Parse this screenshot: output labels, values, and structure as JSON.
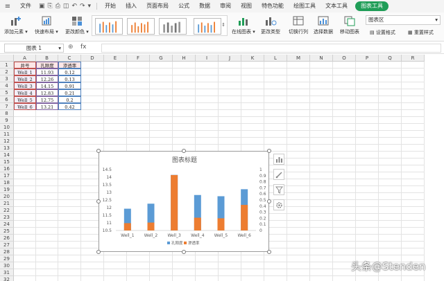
{
  "menu": {
    "items": [
      "文件",
      "开始",
      "插入",
      "页面布局",
      "公式",
      "数据",
      "审阅",
      "视图",
      "特色功能",
      "绘图工具",
      "文本工具"
    ],
    "active": "图表工具"
  },
  "ribbon": {
    "add_element": "添加元素",
    "quick_layout": "快速布局",
    "change_color": "更改颜色",
    "online_chart": "在线图表",
    "change_type": "更改类型",
    "switch_row_col": "切换行列",
    "select_data": "选择数据",
    "move_chart": "移动图表",
    "chart_area_select": "图表区",
    "set_format": "设置格式",
    "reset_style": "重置样式"
  },
  "formula_bar": {
    "name_box": "图表 1",
    "fx": "fx"
  },
  "sheet": {
    "columns": [
      "A",
      "B",
      "C",
      "D",
      "E",
      "F",
      "G",
      "H",
      "I",
      "J",
      "K",
      "L",
      "M",
      "N",
      "O",
      "P",
      "Q",
      "R"
    ],
    "rows": [
      "1",
      "2",
      "3",
      "4",
      "5",
      "6",
      "7",
      "8",
      "9",
      "10",
      "11",
      "12",
      "13",
      "14",
      "15",
      "16",
      "17",
      "18",
      "19",
      "20",
      "21",
      "22",
      "23",
      "24",
      "25",
      "26",
      "27",
      "28",
      "29",
      "30",
      "31",
      "32"
    ],
    "header": [
      "井号",
      "孔隙度",
      "渗透率"
    ],
    "data": [
      [
        "Well_1",
        "11.93",
        "0.12"
      ],
      [
        "Well_2",
        "12.26",
        "0.13"
      ],
      [
        "Well_3",
        "14.15",
        "0.91"
      ],
      [
        "Well_4",
        "12.83",
        "0.21"
      ],
      [
        "Well_5",
        "12.75",
        "0.2"
      ],
      [
        "Well_6",
        "13.21",
        "0.42"
      ]
    ]
  },
  "chart_data": {
    "type": "bar",
    "title": "图表标题",
    "categories": [
      "Well_1",
      "Well_2",
      "Well_3",
      "Well_4",
      "Well_5",
      "Well_6"
    ],
    "series": [
      {
        "name": "孔隙度",
        "axis": "left",
        "values": [
          11.93,
          12.26,
          14.15,
          12.83,
          12.75,
          13.21
        ],
        "color": "#5b9bd5"
      },
      {
        "name": "渗透率",
        "axis": "right",
        "values": [
          0.12,
          0.13,
          0.91,
          0.21,
          0.2,
          0.42
        ],
        "color": "#ed7d31"
      }
    ],
    "y_left": {
      "min": 10.5,
      "max": 14.5,
      "ticks": [
        "14.5",
        "14",
        "13.5",
        "13",
        "12.5",
        "12",
        "11.5",
        "11",
        "10.5"
      ]
    },
    "y_right": {
      "min": 0,
      "max": 1,
      "ticks": [
        "1",
        "0.9",
        "0.8",
        "0.7",
        "0.6",
        "0.5",
        "0.4",
        "0.3",
        "0.2",
        "0.1",
        "0"
      ]
    },
    "legend": "bottom",
    "grid": false
  },
  "watermark": "头条@Stenden"
}
